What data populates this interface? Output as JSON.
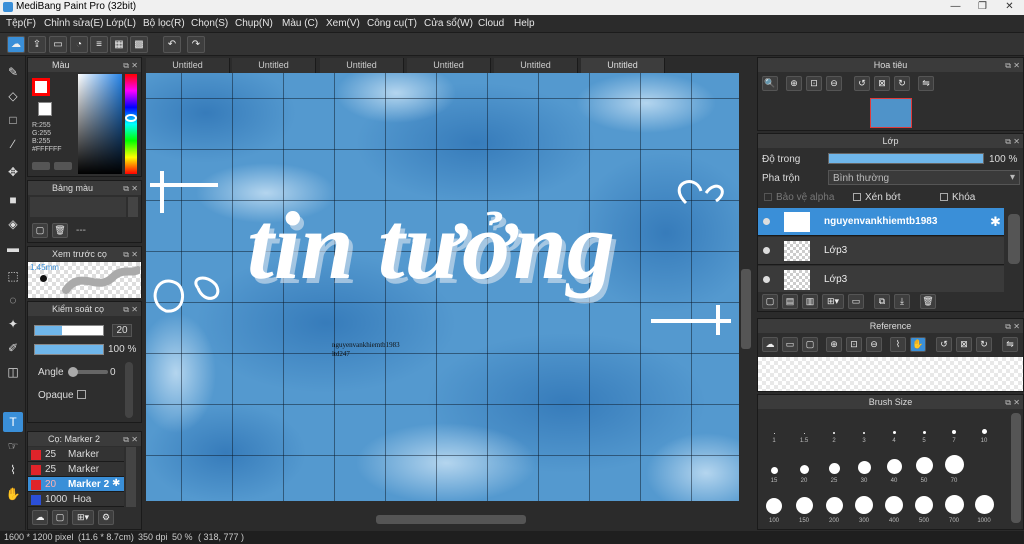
{
  "app": {
    "title": "MediBang Paint Pro (32bit)"
  },
  "window_controls": {
    "minimize": "—",
    "maximize": "❐",
    "close": "✕"
  },
  "menu": [
    "Tệp(F)",
    "Chỉnh sửa(E)",
    "Lớp(L)",
    "Bộ lọc(R)",
    "Chọn(S)",
    "Chụp(N)",
    "Màu (C)",
    "Xem(V)",
    "Công cụ(T)",
    "Cửa sổ(W)",
    "Cloud",
    "Help"
  ],
  "toolbar": {
    "undo": "↶",
    "redo": "↷"
  },
  "tabs": [
    "Untitled",
    "Untitled",
    "Untitled",
    "Untitled",
    "Untitled",
    "Untitled"
  ],
  "color_panel": {
    "title": "Màu",
    "r": "R:255",
    "g": "G:255",
    "b": "B:255",
    "hex": "#FFFFFF",
    "fg_color": "#ff0000",
    "bg_color": "#ffffff"
  },
  "palette_panel": {
    "title": "Bảng màu",
    "dash": "---"
  },
  "brush_preview": {
    "title": "Xem trước cọ",
    "size": "1.45mm"
  },
  "brush_control": {
    "title": "Kiểm soát cọ",
    "size_value": "20",
    "opacity_value": "100 %",
    "angle_label": "Angle",
    "angle_value": "0",
    "opaque_label": "Opaque"
  },
  "brush_list": {
    "title": "Cọ: Marker 2",
    "items": [
      {
        "size": "25",
        "name": "Marker",
        "color": "#e0242a"
      },
      {
        "size": "25",
        "name": "Marker",
        "color": "#e0242a"
      },
      {
        "size": "20",
        "name": "Marker 2",
        "color": "#e0242a"
      },
      {
        "size": "1000",
        "name": "Hoa",
        "color": "#2b4fd8"
      }
    ]
  },
  "navigator": {
    "title": "Hoa tiêu"
  },
  "layers_panel": {
    "title": "Lớp",
    "opacity_label": "Độ trong",
    "opacity_value": "100 %",
    "opacity_fraction": 1.0,
    "blend_label": "Pha trộn",
    "blend_value": "Bình thường",
    "protect_alpha": "Bảo vệ alpha",
    "clipping": "Xén bớt",
    "lock": "Khóa",
    "layers": [
      {
        "name": "nguyenvankhiemtb1983",
        "selected": true
      },
      {
        "name": "Lớp3",
        "selected": false
      },
      {
        "name": "Lớp3",
        "selected": false
      }
    ]
  },
  "reference": {
    "title": "Reference"
  },
  "brush_size": {
    "title": "Brush Size",
    "sizes": [
      "1",
      "1.5",
      "2",
      "3",
      "4",
      "5",
      "7",
      "10",
      "15",
      "20",
      "25",
      "30",
      "40",
      "50",
      "70",
      "100",
      "150",
      "200",
      "300",
      "400",
      "500",
      "700",
      "1000"
    ]
  },
  "canvas": {
    "main_text": "tin tưởng",
    "small_text_line1": "nguyenvankhiemtb1983",
    "small_text_line2": "ltd247"
  },
  "status": {
    "dims": "1600 * 1200 pixel",
    "cm": "(11.6 * 8.7cm)",
    "dpi": "350 dpi",
    "zoom": "50 %",
    "coords": "( 318, 777 )"
  }
}
